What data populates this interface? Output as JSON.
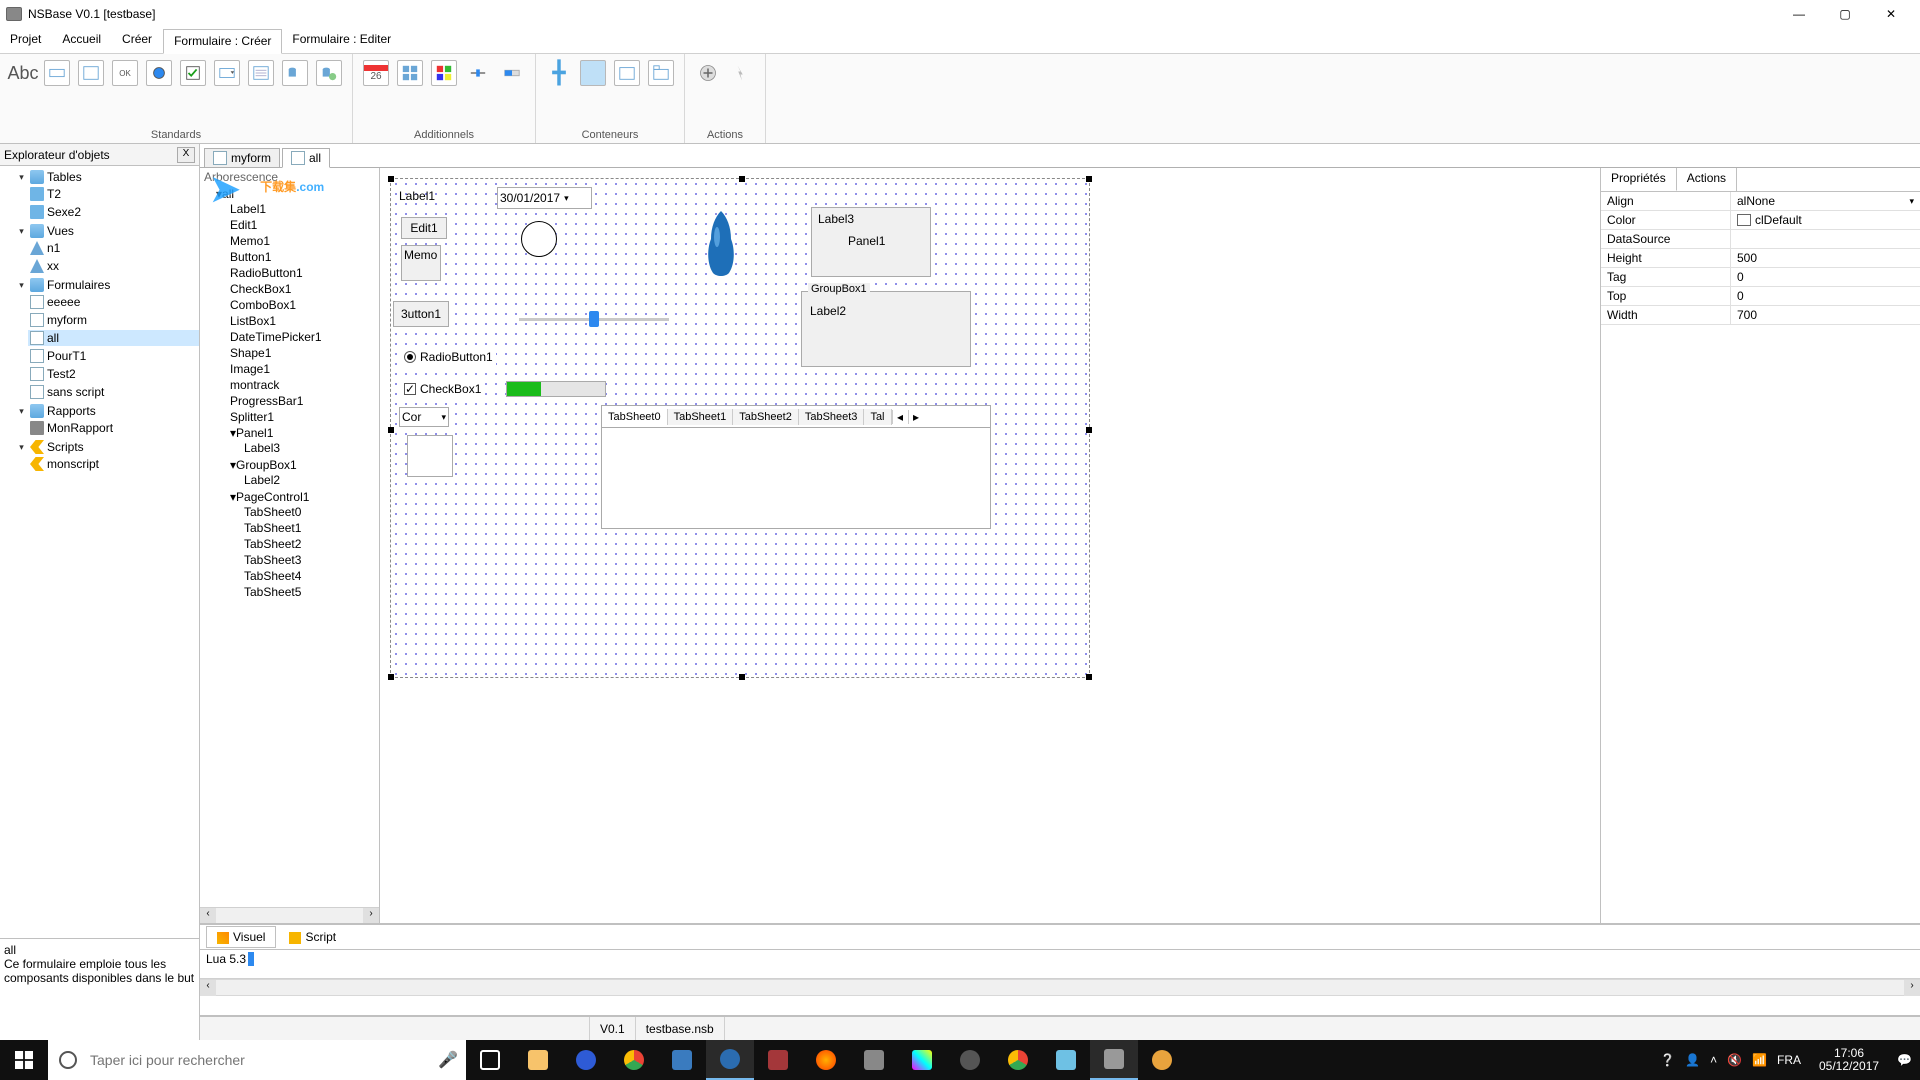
{
  "title": "NSBase V0.1 [testbase]",
  "menu": {
    "projet": "Projet",
    "accueil": "Accueil",
    "creer": "Créer",
    "form_creer": "Formulaire : Créer",
    "form_editer": "Formulaire : Editer"
  },
  "ribbon": {
    "standards": "Standards",
    "additionnels": "Additionnels",
    "conteneurs": "Conteneurs",
    "actions": "Actions",
    "abc": "Abc",
    "ok": "OK",
    "cal_day": "26"
  },
  "explorer": {
    "title": "Explorateur d'objets",
    "close": "X",
    "tables": "Tables",
    "t2": "T2",
    "sexe2": "Sexe2",
    "vues": "Vues",
    "n1": "n1",
    "xx": "xx",
    "formulaires": "Formulaires",
    "eeeee": "eeeee",
    "myform": "myform",
    "all": "all",
    "pourt1": "PourT1",
    "test2": "Test2",
    "sans_script": "sans script",
    "rapports": "Rapports",
    "monrapport": "MonRapport",
    "scripts": "Scripts",
    "monscript": "monscript"
  },
  "desc": {
    "name": "all",
    "text": "Ce formulaire emploie tous les composants disponibles dans le but"
  },
  "doc_tabs": {
    "myform": "myform",
    "all": "all"
  },
  "arbo": {
    "title": "Arborescence",
    "watermark": "下载集",
    "watermark_sub": ".com",
    "all": "all",
    "items": [
      "Label1",
      "Edit1",
      "Memo1",
      "Button1",
      "RadioButton1",
      "CheckBox1",
      "ComboBox1",
      "ListBox1",
      "DateTimePicker1",
      "Shape1",
      "Image1",
      "montrack",
      "ProgressBar1",
      "Splitter1"
    ],
    "panel1": "Panel1",
    "label3": "Label3",
    "groupbox1": "GroupBox1",
    "label2": "Label2",
    "pagecontrol1": "PageControl1",
    "tabsheets": [
      "TabSheet0",
      "TabSheet1",
      "TabSheet2",
      "TabSheet3",
      "TabSheet4",
      "TabSheet5"
    ]
  },
  "canvas": {
    "label1": "Label1",
    "date": "30/01/2017",
    "edit1": "Edit1",
    "memo": "Memo",
    "button1": "3utton1",
    "radiobutton1": "RadioButton1",
    "checkbox1": "CheckBox1",
    "combo": "Cor",
    "label3": "Label3",
    "panel1": "Panel1",
    "groupbox1": "GroupBox1",
    "label2": "Label2",
    "tabs": [
      "TabSheet0",
      "TabSheet1",
      "TabSheet2",
      "TabSheet3",
      "Tal"
    ]
  },
  "view_tabs": {
    "visuel": "Visuel",
    "script": "Script"
  },
  "console": {
    "lua": "Lua 5.3"
  },
  "statusbar": {
    "version": "V0.1",
    "file": "testbase.nsb"
  },
  "props": {
    "tab_props": "Propriétés",
    "tab_actions": "Actions",
    "rows": {
      "align_k": "Align",
      "align_v": "alNone",
      "color_k": "Color",
      "color_v": "clDefault",
      "datasource_k": "DataSource",
      "datasource_v": "",
      "height_k": "Height",
      "height_v": "500",
      "tag_k": "Tag",
      "tag_v": "0",
      "top_k": "Top",
      "top_v": "0",
      "width_k": "Width",
      "width_v": "700"
    }
  },
  "taskbar": {
    "search_placeholder": "Taper ici pour rechercher",
    "lang": "FRA",
    "time": "17:06",
    "date": "05/12/2017"
  }
}
